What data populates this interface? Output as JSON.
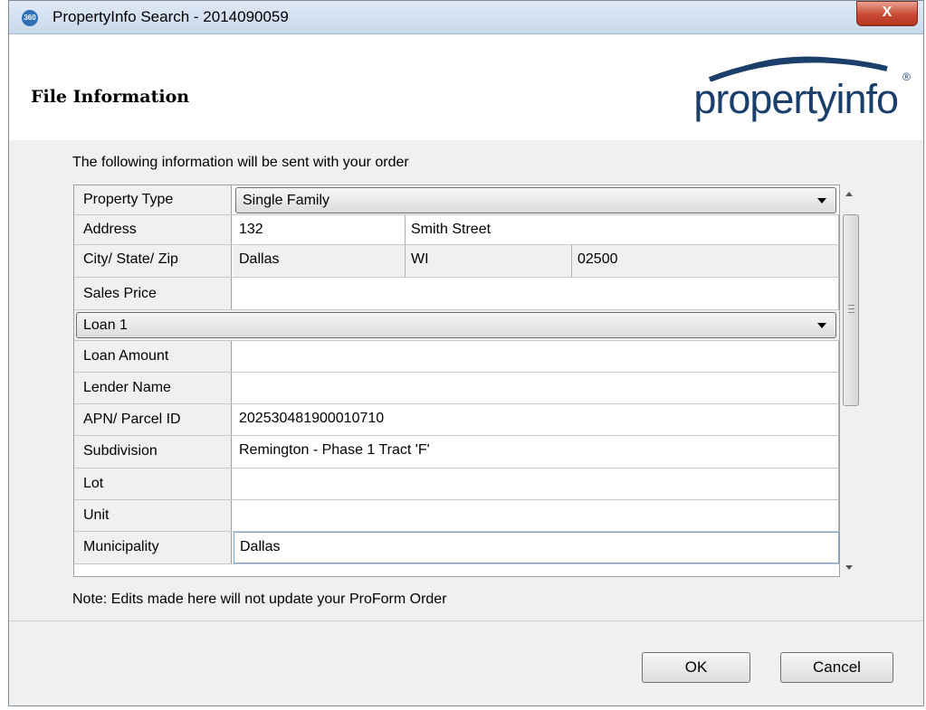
{
  "window": {
    "app_icon": "360",
    "title": "PropertyInfo Search - 2014090059",
    "close_label": "X"
  },
  "header": {
    "title": "File Information",
    "logo_text": "propertyinfo",
    "logo_mark": "®"
  },
  "intro_text": "The following information will be sent with your order",
  "form": {
    "property_type_label": "Property Type",
    "property_type_value": "Single Family",
    "address_label": "Address",
    "address_number": "132",
    "address_street": "Smith Street",
    "city_state_zip_label": "City/ State/ Zip",
    "city": "Dallas",
    "state": "WI",
    "zip": "02500",
    "sales_price_label": "Sales Price",
    "sales_price_value": "",
    "loan_selector_value": "Loan 1",
    "loan_amount_label": "Loan Amount",
    "loan_amount_value": "",
    "lender_name_label": "Lender Name",
    "lender_name_value": "",
    "apn_label": "APN/ Parcel ID",
    "apn_value": "202530481900010710",
    "subdivision_label": "Subdivision",
    "subdivision_value": "Remington - Phase 1 Tract 'F'",
    "lot_label": "Lot",
    "lot_value": "",
    "unit_label": "Unit",
    "unit_value": "",
    "municipality_label": "Municipality",
    "municipality_value": "Dallas"
  },
  "note_text": "Note:  Edits made here will not update your ProForm Order",
  "buttons": {
    "ok": "OK",
    "cancel": "Cancel"
  },
  "colors": {
    "logo_blue": "#1b3f6b",
    "close_red": "#c84b36"
  }
}
